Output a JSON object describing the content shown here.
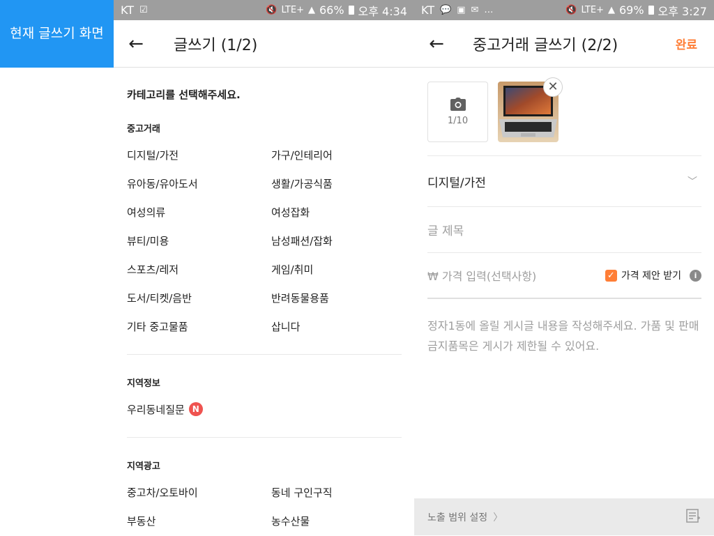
{
  "label_tab": "현재 글쓰기 화면",
  "screen1": {
    "status": {
      "carrier": "KT",
      "battery": "66%",
      "time": "오후 4:34",
      "network": "LTE+"
    },
    "title": "글쓰기 (1/2)",
    "prompt": "카테고리를 선택해주세요.",
    "sections": [
      {
        "title": "중고거래",
        "items": [
          "디지털/가전",
          "가구/인테리어",
          "유아동/유아도서",
          "생활/가공식품",
          "여성의류",
          "여성잡화",
          "뷰티/미용",
          "남성패션/잡화",
          "스포츠/레저",
          "게임/취미",
          "도서/티켓/음반",
          "반려동물용품",
          "기타 중고물품",
          "삽니다"
        ]
      },
      {
        "title": "지역정보",
        "items": [
          "우리동네질문"
        ],
        "badge": "N"
      },
      {
        "title": "지역광고",
        "items": [
          "중고차/오토바이",
          "동네 구인구직",
          "부동산",
          "농수산물"
        ]
      }
    ]
  },
  "screen2": {
    "status": {
      "carrier": "KT",
      "battery": "69%",
      "time": "오후 3:27",
      "network": "LTE+"
    },
    "title": "중고거래 글쓰기 (2/2)",
    "done_label": "완료",
    "photo_count": "1/10",
    "category": "디지털/가전",
    "title_placeholder": "글 제목",
    "price_placeholder": "₩ 가격 입력(선택사항)",
    "price_offer_label": "가격 제안 받기",
    "content_placeholder": "정자1동에 올릴 게시글 내용을 작성해주세요. 가품 및 판매금지품목은 게시가 제한될 수 있어요.",
    "exposure_label": "노출 범위 설정",
    "colors": {
      "accent": "#ff7e36",
      "badge": "#ef5350",
      "label_tab": "#2196f3"
    }
  }
}
